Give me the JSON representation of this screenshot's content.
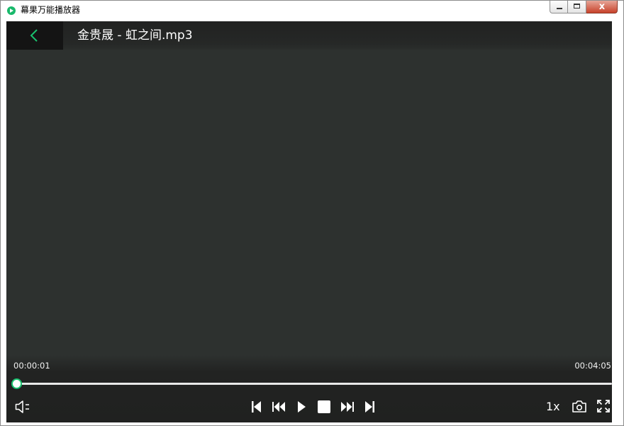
{
  "window": {
    "title": "幕果万能播放器",
    "app_icon": "play-circle-icon",
    "close_glyph": "x"
  },
  "player": {
    "title": "金贵晟 - 虹之间.mp3",
    "current_time": "00:00:01",
    "duration": "00:04:05",
    "progress_fraction": 0.004,
    "speed_label": "1x",
    "accent_color": "#19c26f"
  }
}
